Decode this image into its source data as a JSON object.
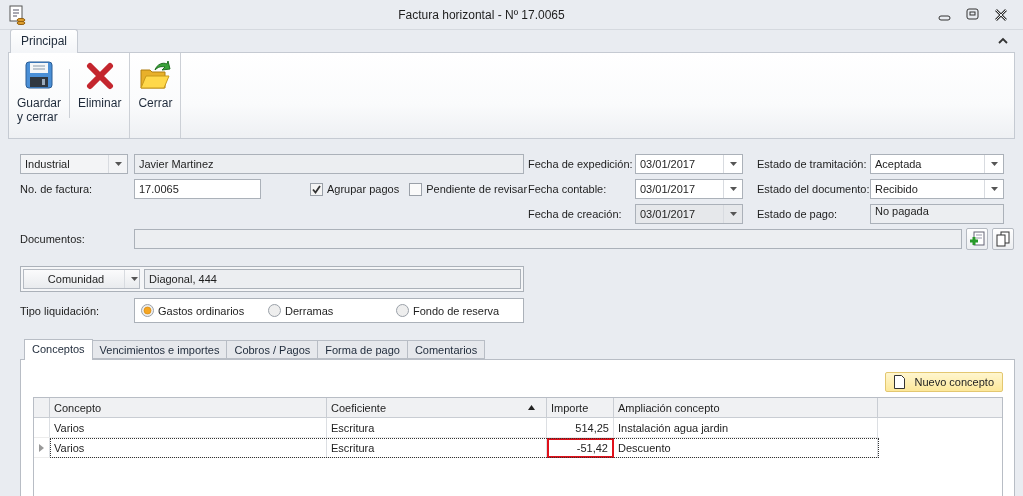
{
  "window": {
    "title": "Factura horizontal - Nº 17.0065"
  },
  "ribbon": {
    "tabs": [
      {
        "label": "Principal",
        "selected": true
      }
    ],
    "buttons": [
      {
        "label": "Guardar\ny cerrar"
      },
      {
        "label": "Eliminar"
      },
      {
        "label": "Cerrar"
      }
    ]
  },
  "form": {
    "party": {
      "type": "Industrial",
      "name": "Javier Martinez"
    },
    "invoice_number": {
      "label": "No. de factura:",
      "value": "17.0065"
    },
    "checkboxes": [
      {
        "label": "Agrupar pagos",
        "checked": true
      },
      {
        "label": "Pendiente de revisar",
        "checked": false
      }
    ],
    "dates": [
      {
        "label": "Fecha de expedición:",
        "value": "03/01/2017",
        "disabled": false
      },
      {
        "label": "Fecha contable:",
        "value": "03/01/2017",
        "disabled": false
      },
      {
        "label": "Fecha de creación:",
        "value": "03/01/2017",
        "disabled": true
      }
    ],
    "statuses": [
      {
        "label": "Estado de tramitación:",
        "value": "Aceptada",
        "kind": "combo"
      },
      {
        "label": "Estado del documento:",
        "value": "Recibido",
        "kind": "combo"
      },
      {
        "label": "Estado de pago:",
        "value": "No pagada",
        "kind": "readonly"
      }
    ],
    "documents": {
      "label": "Documentos:"
    },
    "community": {
      "button": "Comunidad",
      "value": "Diagonal, 444"
    },
    "liquidation": {
      "label": "Tipo liquidación:",
      "options": [
        {
          "label": "Gastos ordinarios",
          "selected": true
        },
        {
          "label": "Derramas",
          "selected": false
        },
        {
          "label": "Fondo de reserva",
          "selected": false
        }
      ]
    }
  },
  "tabs": [
    {
      "label": "Conceptos",
      "selected": true
    },
    {
      "label": "Vencimientos e importes",
      "selected": false
    },
    {
      "label": "Cobros / Pagos",
      "selected": false
    },
    {
      "label": "Forma de pago",
      "selected": false
    },
    {
      "label": "Comentarios",
      "selected": false
    }
  ],
  "new_button": "Nuevo concepto",
  "table": {
    "columns": [
      {
        "label": "Concepto",
        "sorted": false
      },
      {
        "label": "Coeficiente",
        "sorted": true
      },
      {
        "label": "Importe",
        "sorted": false
      },
      {
        "label": "Ampliación concepto",
        "sorted": false
      }
    ],
    "rows": [
      {
        "selected": false,
        "cells": [
          {
            "text": "Varios",
            "flagged": false
          },
          {
            "text": "Escritura",
            "flagged": false
          },
          {
            "text": "514,25",
            "flagged": false
          },
          {
            "text": "Instalación agua jardin",
            "flagged": false
          }
        ]
      },
      {
        "selected": true,
        "cells": [
          {
            "text": "Varios",
            "flagged": false
          },
          {
            "text": "Escritura",
            "flagged": false
          },
          {
            "text": "-51,42",
            "flagged": true
          },
          {
            "text": "Descuento",
            "flagged": false
          }
        ]
      }
    ]
  }
}
